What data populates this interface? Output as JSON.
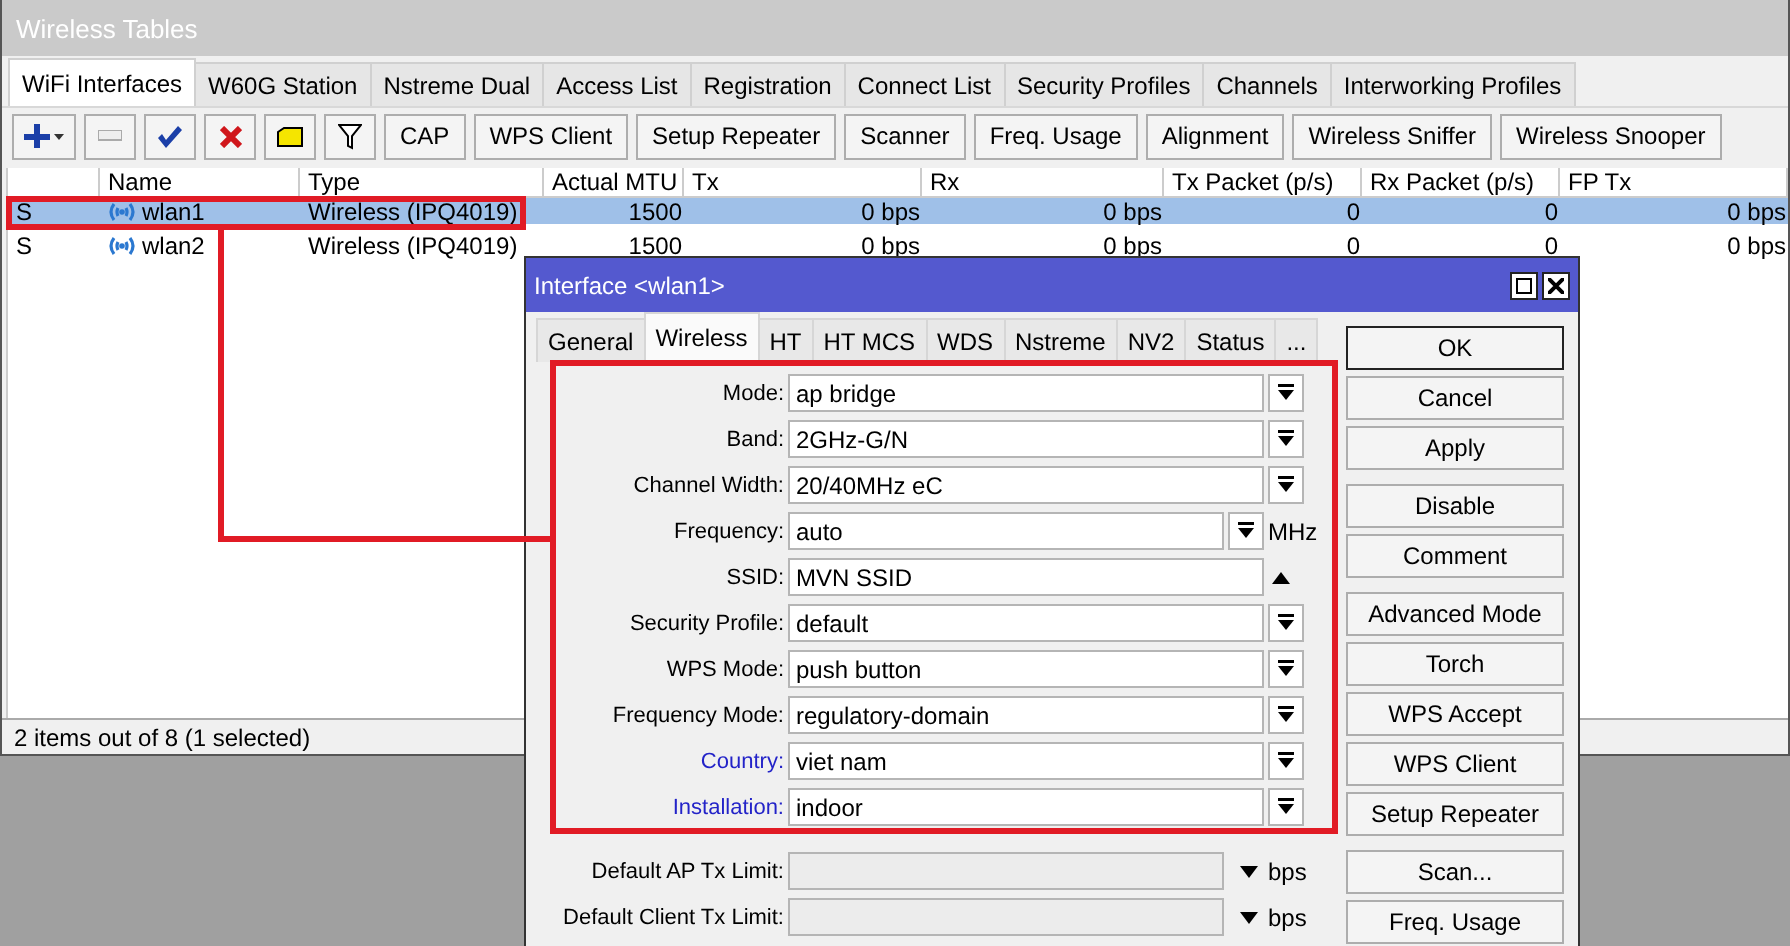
{
  "window": {
    "title": "Wireless Tables"
  },
  "tabs": [
    {
      "label": "WiFi Interfaces",
      "selected": true
    },
    {
      "label": "W60G Station",
      "selected": false
    },
    {
      "label": "Nstreme Dual",
      "selected": false
    },
    {
      "label": "Access List",
      "selected": false
    },
    {
      "label": "Registration",
      "selected": false
    },
    {
      "label": "Connect List",
      "selected": false
    },
    {
      "label": "Security Profiles",
      "selected": false
    },
    {
      "label": "Channels",
      "selected": false
    },
    {
      "label": "Interworking Profiles",
      "selected": false
    }
  ],
  "toolbar": {
    "icon_buttons": [
      {
        "kind": "add"
      },
      {
        "kind": "remove"
      },
      {
        "kind": "enable"
      },
      {
        "kind": "disable"
      },
      {
        "kind": "comment"
      },
      {
        "kind": "filter"
      }
    ],
    "buttons": [
      "CAP",
      "WPS Client",
      "Setup Repeater",
      "Scanner",
      "Freq. Usage",
      "Alignment",
      "Wireless Sniffer",
      "Wireless Snooper"
    ]
  },
  "table": {
    "columns": [
      "",
      "Name",
      "Type",
      "Actual MTU",
      "Tx",
      "Rx",
      "Tx Packet (p/s)",
      "Rx Packet (p/s)",
      "FP Tx"
    ],
    "rows": [
      {
        "selected": true,
        "cells": [
          "S",
          "wlan1",
          "Wireless (IPQ4019)",
          "1500",
          "0 bps",
          "0 bps",
          "0",
          "0",
          "0 bps"
        ]
      },
      {
        "selected": false,
        "cells": [
          "S",
          "wlan2",
          "Wireless (IPQ4019)",
          "1500",
          "0 bps",
          "0 bps",
          "0",
          "0",
          "0 bps"
        ]
      }
    ]
  },
  "status_bar": "2 items out of 8 (1 selected)",
  "dialog": {
    "title": "Interface <wlan1>",
    "tabs": [
      {
        "label": "General",
        "selected": false
      },
      {
        "label": "Wireless",
        "selected": true
      },
      {
        "label": "HT",
        "selected": false
      },
      {
        "label": "HT MCS",
        "selected": false
      },
      {
        "label": "WDS",
        "selected": false
      },
      {
        "label": "Nstreme",
        "selected": false
      },
      {
        "label": "NV2",
        "selected": false
      },
      {
        "label": "Status",
        "selected": false
      },
      {
        "label": "...",
        "selected": false
      }
    ],
    "fields": [
      {
        "label": "Mode:",
        "value": "ap bridge",
        "kind": "select",
        "highlighted": false
      },
      {
        "label": "Band:",
        "value": "2GHz-G/N",
        "kind": "select",
        "highlighted": false
      },
      {
        "label": "Channel Width:",
        "value": "20/40MHz eC",
        "kind": "select",
        "highlighted": false
      },
      {
        "label": "Frequency:",
        "value": "auto",
        "kind": "select",
        "unit": "MHz",
        "highlighted": false
      },
      {
        "label": "SSID:",
        "value": "MVN SSID",
        "kind": "expand",
        "highlighted": false
      },
      {
        "label": "Security Profile:",
        "value": "default",
        "kind": "select",
        "highlighted": false
      },
      {
        "label": "WPS Mode:",
        "value": "push button",
        "kind": "select",
        "highlighted": false
      },
      {
        "label": "Frequency Mode:",
        "value": "regulatory-domain",
        "kind": "select",
        "highlighted": false
      },
      {
        "label": "Country:",
        "value": "viet nam",
        "kind": "select",
        "highlighted": true
      },
      {
        "label": "Installation:",
        "value": "indoor",
        "kind": "select",
        "highlighted": true
      },
      {
        "label": "Default AP Tx Limit:",
        "kind": "limit",
        "unit": "bps",
        "highlighted": false
      },
      {
        "label": "Default Client Tx Limit:",
        "kind": "limit",
        "unit": "bps",
        "highlighted": false
      }
    ],
    "button_groups": [
      [
        {
          "label": "OK",
          "default": true
        },
        {
          "label": "Cancel",
          "default": false
        },
        {
          "label": "Apply",
          "default": false
        }
      ],
      [
        {
          "label": "Disable",
          "default": false
        },
        {
          "label": "Comment",
          "default": false
        }
      ],
      [
        {
          "label": "Advanced Mode",
          "default": false
        },
        {
          "label": "Torch",
          "default": false
        },
        {
          "label": "WPS Accept",
          "default": false
        },
        {
          "label": "WPS Client",
          "default": false
        },
        {
          "label": "Setup Repeater",
          "default": false
        }
      ],
      [
        {
          "label": "Scan...",
          "default": false
        },
        {
          "label": "Freq. Usage",
          "default": false
        }
      ]
    ]
  }
}
